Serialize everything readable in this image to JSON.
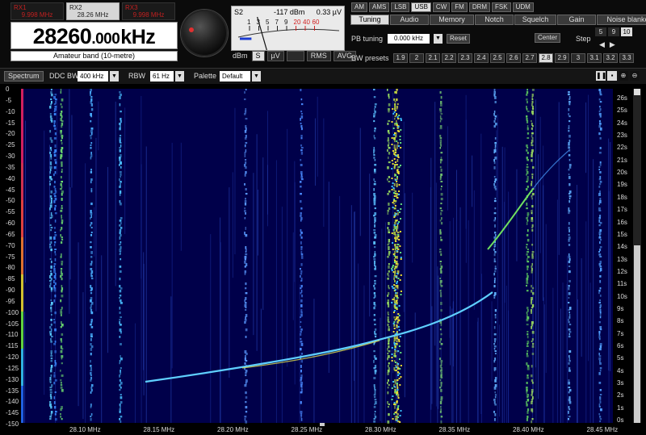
{
  "receivers": [
    {
      "name": "RX1",
      "freq": "9.998 MHz",
      "active": false
    },
    {
      "name": "RX2",
      "freq": "28.26 MHz",
      "active": true
    },
    {
      "name": "RX3",
      "freq": "9.998 MHz",
      "active": false
    }
  ],
  "frequency": {
    "major": "28260",
    "minor": ".000",
    "unit": "kHz",
    "band": "Amateur band (10-metre)"
  },
  "smeter": {
    "s_reading": "S2",
    "dbm_reading": "-117 dBm",
    "uv_reading": "0.33 µV",
    "scale_black": [
      "1",
      "3",
      "5",
      "7",
      "9"
    ],
    "scale_red": [
      "20",
      "40",
      "60"
    ],
    "level_percent": 12
  },
  "meter_controls": {
    "dbm": "dBm",
    "s": "S",
    "uv": "µV",
    "rms": "RMS",
    "avg": "AVG"
  },
  "modes": [
    {
      "label": "AM",
      "on": false
    },
    {
      "label": "AMS",
      "on": false
    },
    {
      "label": "LSB",
      "on": false
    },
    {
      "label": "USB",
      "on": true
    },
    {
      "label": "CW",
      "on": false
    },
    {
      "label": "FM",
      "on": false
    },
    {
      "label": "DRM",
      "on": false
    },
    {
      "label": "FSK",
      "on": false
    },
    {
      "label": "UDM",
      "on": false
    }
  ],
  "panel_tabs": [
    {
      "label": "Tuning",
      "on": true
    },
    {
      "label": "Audio",
      "on": false
    },
    {
      "label": "Memory",
      "on": false
    },
    {
      "label": "Notch",
      "on": false
    },
    {
      "label": "Squelch",
      "on": false
    },
    {
      "label": "Gain",
      "on": false
    },
    {
      "label": "Noise blanker",
      "on": false
    }
  ],
  "tuning": {
    "pb_label": "PB tuning",
    "pb_value": "0.000 kHz",
    "reset": "Reset",
    "center": "Center",
    "step_label": "Step",
    "steps": [
      {
        "v": "5",
        "on": false
      },
      {
        "v": "9",
        "on": false
      },
      {
        "v": "10",
        "on": true
      }
    ],
    "bw_label": "BW presets",
    "bw_presets": [
      {
        "v": "1.9",
        "on": false
      },
      {
        "v": "2",
        "on": false
      },
      {
        "v": "2.1",
        "on": false
      },
      {
        "v": "2.2",
        "on": false
      },
      {
        "v": "2.3",
        "on": false
      },
      {
        "v": "2.4",
        "on": false
      },
      {
        "v": "2.5",
        "on": false
      },
      {
        "v": "2.6",
        "on": false
      },
      {
        "v": "2.7",
        "on": false
      },
      {
        "v": "2.8",
        "on": true
      },
      {
        "v": "2.9",
        "on": false
      },
      {
        "v": "3",
        "on": false
      },
      {
        "v": "3.1",
        "on": false
      },
      {
        "v": "3.2",
        "on": false
      },
      {
        "v": "3.3",
        "on": false
      }
    ]
  },
  "toolbar": {
    "spectrum": "Spectrum",
    "ddc_label": "DDC BW",
    "ddc_value": "400 kHz",
    "rbw_label": "RBW",
    "rbw_value": "61 Hz",
    "palette_label": "Palette",
    "palette_value": "Default",
    "icons": [
      "pause-icon",
      "save-icon",
      "zoom-in-icon",
      "zoom-out-icon"
    ]
  },
  "waterfall": {
    "db_ticks": [
      "0",
      "-5",
      "-10",
      "-15",
      "-20",
      "-25",
      "-30",
      "-35",
      "-40",
      "-45",
      "-50",
      "-55",
      "-60",
      "-65",
      "-70",
      "-75",
      "-80",
      "-85",
      "-90",
      "-95",
      "-100",
      "-105",
      "-110",
      "-115",
      "-120",
      "-125",
      "-130",
      "-135",
      "-140",
      "-145",
      "-150"
    ],
    "time_ticks": [
      "26s",
      "25s",
      "24s",
      "23s",
      "22s",
      "21s",
      "20s",
      "19s",
      "18s",
      "17s",
      "16s",
      "15s",
      "14s",
      "13s",
      "12s",
      "11s",
      "10s",
      "9s",
      "8s",
      "7s",
      "6s",
      "5s",
      "4s",
      "3s",
      "2s",
      "1s",
      "0s"
    ],
    "freq_ticks": [
      "28.10 MHz",
      "28.15 MHz",
      "28.20 MHz",
      "28.25 MHz",
      "28.30 MHz",
      "28.35 MHz",
      "28.40 MHz",
      "28.45 MHz"
    ]
  }
}
